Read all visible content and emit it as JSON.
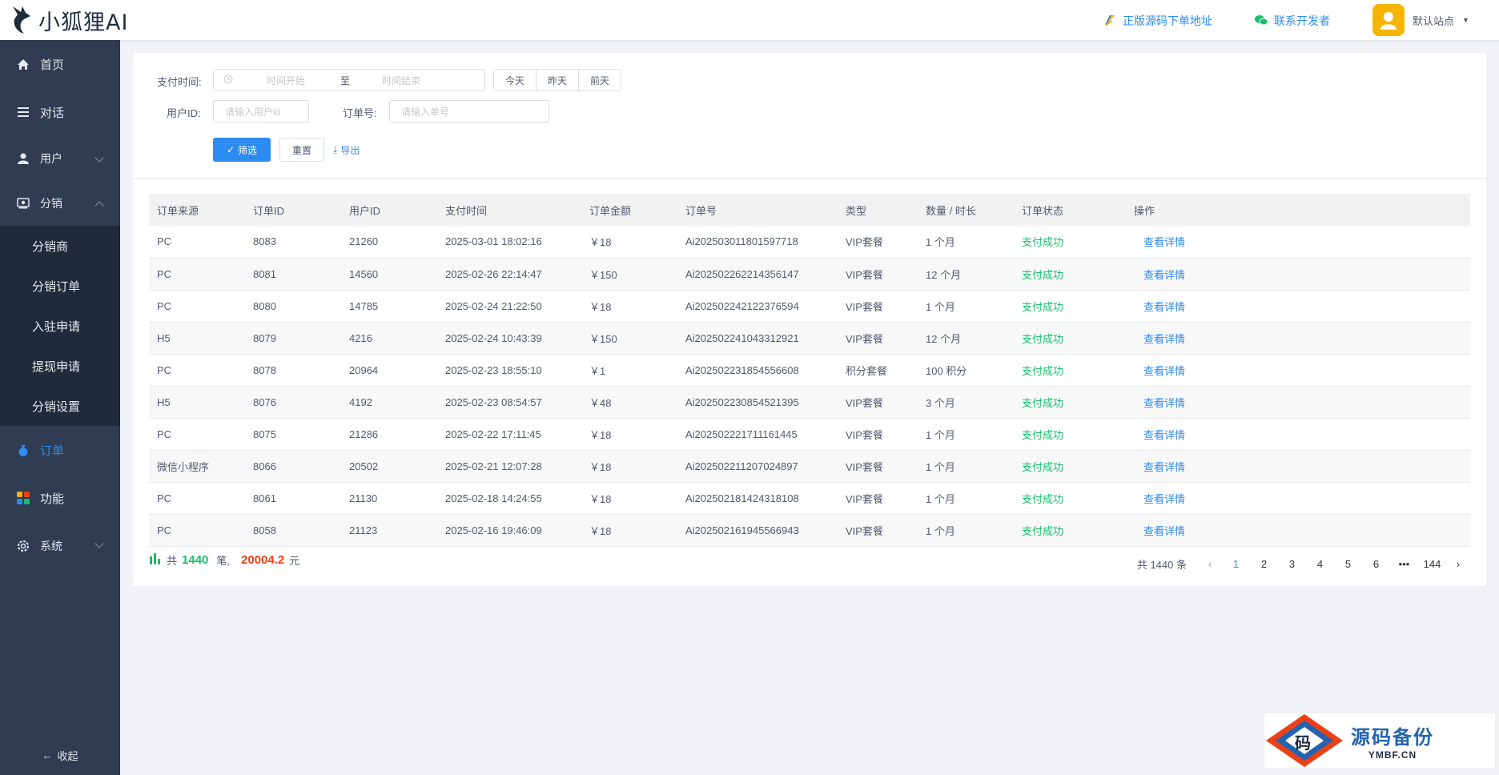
{
  "app": {
    "logo_text": "小狐狸AI"
  },
  "header": {
    "source_link": "正版源码下单地址",
    "contact_link": "联系开发者",
    "user_name": "默认站点"
  },
  "sidebar": {
    "items": [
      {
        "label": "首页",
        "icon": "home-icon"
      },
      {
        "label": "对话",
        "icon": "list-icon"
      },
      {
        "label": "用户",
        "icon": "user-icon"
      },
      {
        "label": "分销",
        "icon": "distribution-icon"
      }
    ],
    "submenu": [
      "分销商",
      "分销订单",
      "入驻申请",
      "提现申请",
      "分销设置"
    ],
    "items2": [
      {
        "label": "订单",
        "icon": "order-icon"
      },
      {
        "label": "功能",
        "icon": "apps-icon"
      },
      {
        "label": "系统",
        "icon": "settings-icon"
      }
    ],
    "collapse": "收起"
  },
  "filter": {
    "pay_time_label": "支付时间:",
    "start_placeholder": "时间开始",
    "sep": "至",
    "end_placeholder": "时间结束",
    "quick": [
      "今天",
      "昨天",
      "前天"
    ],
    "user_id_label": "用户ID:",
    "user_id_placeholder": "请输入用户id",
    "order_no_label": "订单号:",
    "order_no_placeholder": "请输入单号",
    "filter_btn": "筛选",
    "reset_btn": "重置",
    "export_btn": "导出"
  },
  "table": {
    "columns": [
      "订单来源",
      "订单ID",
      "用户ID",
      "支付时间",
      "订单金额",
      "订单号",
      "类型",
      "数量 / 时长",
      "订单状态",
      "操作"
    ],
    "rows": [
      [
        "PC",
        "8083",
        "21260",
        "2025-03-01 18:02:16",
        "￥18",
        "Ai202503011801597718",
        "VIP套餐",
        "1 个月",
        "支付成功",
        "查看详情"
      ],
      [
        "PC",
        "8081",
        "14560",
        "2025-02-26 22:14:47",
        "￥150",
        "Ai202502262214356147",
        "VIP套餐",
        "12 个月",
        "支付成功",
        "查看详情"
      ],
      [
        "PC",
        "8080",
        "14785",
        "2025-02-24 21:22:50",
        "￥18",
        "Ai202502242122376594",
        "VIP套餐",
        "1 个月",
        "支付成功",
        "查看详情"
      ],
      [
        "H5",
        "8079",
        "4216",
        "2025-02-24 10:43:39",
        "￥150",
        "Ai202502241043312921",
        "VIP套餐",
        "12 个月",
        "支付成功",
        "查看详情"
      ],
      [
        "PC",
        "8078",
        "20964",
        "2025-02-23 18:55:10",
        "￥1",
        "Ai202502231854556608",
        "积分套餐",
        "100 积分",
        "支付成功",
        "查看详情"
      ],
      [
        "H5",
        "8076",
        "4192",
        "2025-02-23 08:54:57",
        "￥48",
        "Ai202502230854521395",
        "VIP套餐",
        "3 个月",
        "支付成功",
        "查看详情"
      ],
      [
        "PC",
        "8075",
        "21286",
        "2025-02-22 17:11:45",
        "￥18",
        "Ai202502221711161445",
        "VIP套餐",
        "1 个月",
        "支付成功",
        "查看详情"
      ],
      [
        "微信小程序",
        "8066",
        "20502",
        "2025-02-21 12:07:28",
        "￥18",
        "Ai202502211207024897",
        "VIP套餐",
        "1 个月",
        "支付成功",
        "查看详情"
      ],
      [
        "PC",
        "8061",
        "21130",
        "2025-02-18 14:24:55",
        "￥18",
        "Ai202502181424318108",
        "VIP套餐",
        "1 个月",
        "支付成功",
        "查看详情"
      ],
      [
        "PC",
        "8058",
        "21123",
        "2025-02-16 19:46:09",
        "￥18",
        "Ai202502161945566943",
        "VIP套餐",
        "1 个月",
        "支付成功",
        "查看详情"
      ]
    ]
  },
  "summary": {
    "prefix": "共",
    "count": "1440",
    "mid": "笔,",
    "amount": "20004.2",
    "suffix": "元"
  },
  "pager": {
    "total": "共 1440 条",
    "pages": [
      "1",
      "2",
      "3",
      "4",
      "5",
      "6",
      "•••",
      "144"
    ],
    "active": "1"
  },
  "watermark": {
    "cn": "源码备份",
    "en": "YMBF.CN",
    "badge": "码"
  },
  "colors": {
    "primary": "#2d8cf0",
    "success": "#19be6b",
    "danger": "#ed4014",
    "sidebar": "#2f3c52"
  }
}
